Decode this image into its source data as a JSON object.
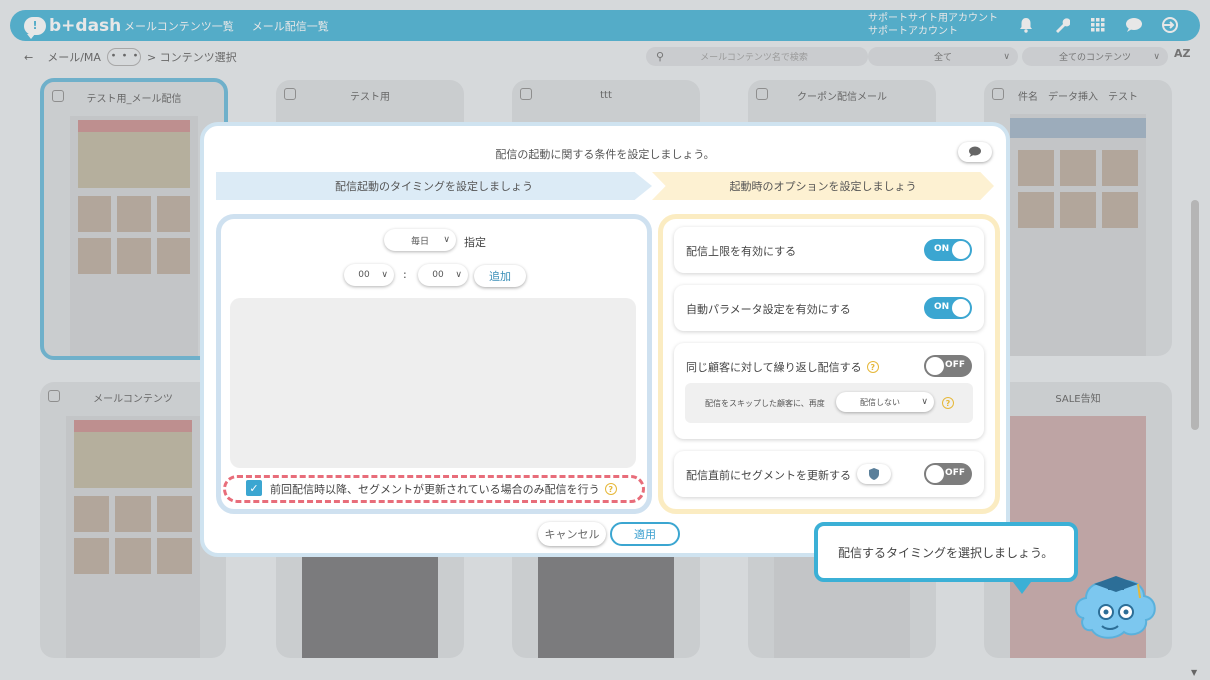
{
  "header": {
    "logo": "b+dash",
    "nav": [
      "メールコンテンツ一覧",
      "メール配信一覧"
    ],
    "account_line1": "サポートサイト用アカウント",
    "account_line2": "サポートアカウント",
    "icons": [
      "bell-icon",
      "wrench-icon",
      "grid-icon",
      "chat-icon",
      "logout-icon"
    ]
  },
  "toolbar": {
    "back": "←",
    "breadcrumb_root": "メール/MA",
    "more": "・・・",
    "breadcrumb_current": "> コンテンツ選択",
    "search_placeholder": "メールコンテンツ名で検索",
    "filter1": "全て",
    "filter2": "全てのコンテンツ",
    "sort": "AZ"
  },
  "cards": [
    {
      "title": "テスト用_メール配信"
    },
    {
      "title": "テスト用"
    },
    {
      "title": "ttt"
    },
    {
      "title": "クーポン配信メール"
    },
    {
      "title": "件名　データ挿入　テスト"
    },
    {
      "title": "メールコンテンツ"
    },
    {
      "title": "SALE告知"
    }
  ],
  "modal": {
    "title": "配信の起動に関する条件を設定しましょう。",
    "step1": "配信起動のタイミングを設定しましょう",
    "step2": "起動時のオプションを設定しましょう",
    "frequency": "毎日",
    "frequency_suffix": "指定",
    "hour": "00",
    "colon": ":",
    "minute": "00",
    "add_button": "追加",
    "checkbox_label": "前回配信時以降、セグメントが更新されている場合のみ配信を行う",
    "checkbox_checked": true,
    "options": [
      {
        "label": "配信上限を有効にする",
        "state": "ON"
      },
      {
        "label": "自動パラメータ設定を有効にする",
        "state": "ON"
      },
      {
        "label": "同じ顧客に対して繰り返し配信する",
        "state": "OFF"
      },
      {
        "label": "配信直前にセグメントを更新する",
        "state": "OFF"
      }
    ],
    "repeat_sub_label": "配信をスキップした顧客に、再度",
    "repeat_sub_select": "配信しない",
    "cancel": "キャンセル",
    "apply": "適用"
  },
  "tooltip": "配信するタイミングを選択しましょう。",
  "colors": {
    "accent": "#3bb0d6",
    "toggle_on": "#3ba6d1",
    "toggle_off": "#7d7d7d",
    "dashed": "#e86d7a"
  }
}
